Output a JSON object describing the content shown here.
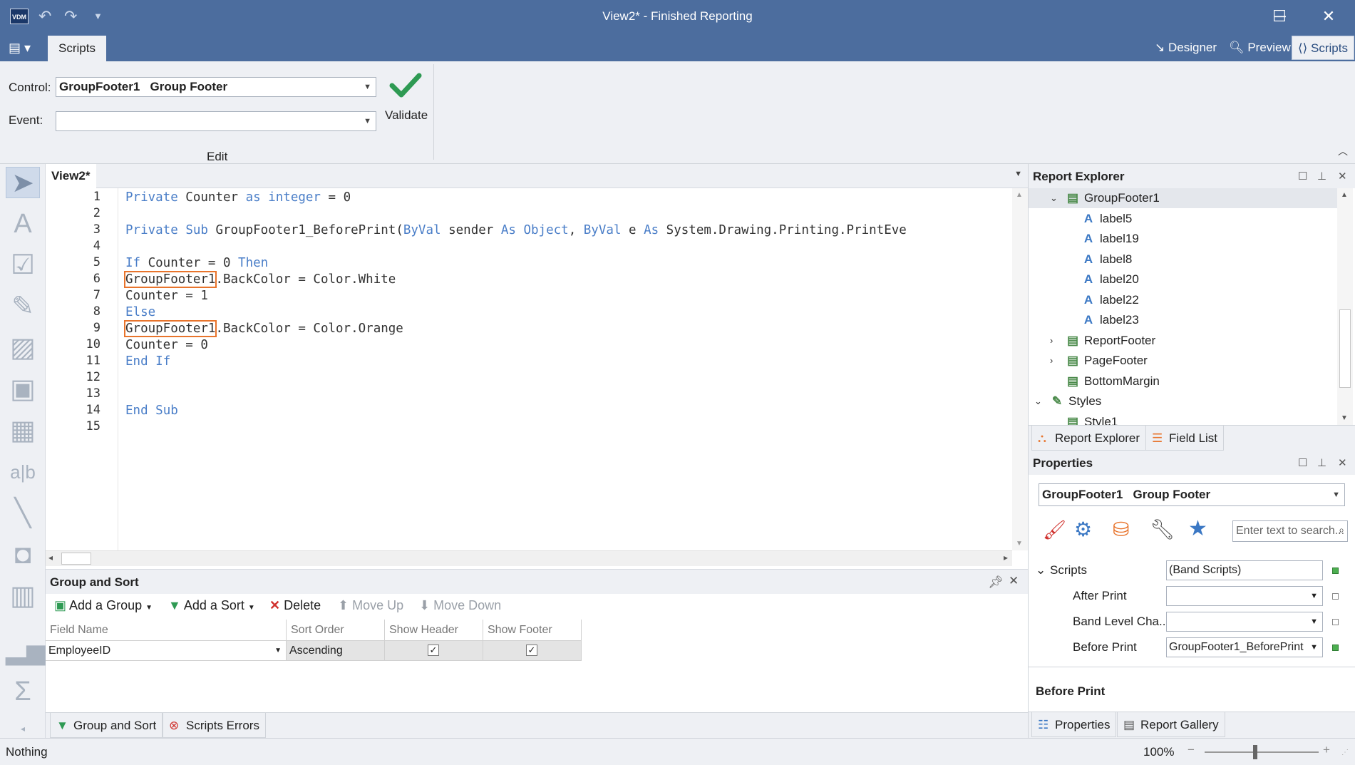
{
  "window": {
    "logo": "VDM",
    "title": "View2* - Finished Reporting",
    "minimize": "─",
    "maximize": "☐",
    "close": "✕"
  },
  "ribbon": {
    "tab_scripts": "Scripts",
    "views": {
      "designer": "Designer",
      "preview": "Preview",
      "scripts": "Scripts"
    },
    "control_label": "Control:",
    "control_value": "GroupFooter1   Group Footer",
    "event_label": "Event:",
    "event_value": "",
    "validate": "Validate",
    "group_label": "Edit"
  },
  "editor": {
    "tab": "View2*",
    "line_numbers": [
      "1",
      "2",
      "3",
      "4",
      "5",
      "6",
      "7",
      "8",
      "9",
      "10",
      "11",
      "12",
      "13",
      "14",
      "15"
    ],
    "lines": [
      {
        "parts": [
          {
            "t": "Private",
            "k": true
          },
          {
            "t": " Counter ",
            "k": false
          },
          {
            "t": "as",
            "k": true
          },
          {
            "t": " ",
            "k": false
          },
          {
            "t": "integer",
            "k": true
          },
          {
            "t": " = 0",
            "k": false
          }
        ]
      },
      {
        "parts": []
      },
      {
        "parts": [
          {
            "t": "Private",
            "k": true
          },
          {
            "t": " ",
            "k": false
          },
          {
            "t": "Sub",
            "k": true
          },
          {
            "t": " GroupFooter1_BeforePrint(",
            "k": false
          },
          {
            "t": "ByVal",
            "k": true
          },
          {
            "t": " sender ",
            "k": false
          },
          {
            "t": "As",
            "k": true
          },
          {
            "t": " ",
            "k": false
          },
          {
            "t": "Object",
            "k": true
          },
          {
            "t": ", ",
            "k": false
          },
          {
            "t": "ByVal",
            "k": true
          },
          {
            "t": " e ",
            "k": false
          },
          {
            "t": "As",
            "k": true
          },
          {
            "t": " System.Drawing.Printing.PrintEve",
            "k": false
          }
        ]
      },
      {
        "parts": []
      },
      {
        "parts": [
          {
            "t": "If",
            "k": true
          },
          {
            "t": " Counter = 0 ",
            "k": false
          },
          {
            "t": "Then",
            "k": true
          }
        ]
      },
      {
        "parts": [
          {
            "t": "GroupFooter1",
            "k": false,
            "h": true
          },
          {
            "t": ".BackColor = Color.White",
            "k": false
          }
        ]
      },
      {
        "parts": [
          {
            "t": "Counter = 1",
            "k": false
          }
        ]
      },
      {
        "parts": [
          {
            "t": "Else",
            "k": true
          }
        ]
      },
      {
        "parts": [
          {
            "t": "GroupFooter1",
            "k": false,
            "h": true
          },
          {
            "t": ".BackColor = Color.Orange",
            "k": false
          }
        ]
      },
      {
        "parts": [
          {
            "t": "Counter = 0",
            "k": false
          }
        ]
      },
      {
        "parts": [
          {
            "t": "End",
            "k": true
          },
          {
            "t": " ",
            "k": false
          },
          {
            "t": "If",
            "k": true
          }
        ]
      },
      {
        "parts": []
      },
      {
        "parts": []
      },
      {
        "parts": [
          {
            "t": "End",
            "k": true
          },
          {
            "t": " ",
            "k": false
          },
          {
            "t": "Sub",
            "k": true
          }
        ]
      },
      {
        "parts": []
      }
    ]
  },
  "group_sort": {
    "title": "Group and Sort",
    "add_group": "Add a Group",
    "add_sort": "Add a Sort",
    "delete": "Delete",
    "move_up": "Move Up",
    "move_down": "Move Down",
    "columns": [
      "Field Name",
      "Sort Order",
      "Show Header",
      "Show Footer"
    ],
    "row": {
      "field": "EmployeeID",
      "order": "Ascending",
      "show_header": true,
      "show_footer": true
    },
    "bottom_tabs": [
      "Group and Sort",
      "Scripts Errors"
    ]
  },
  "report_explorer": {
    "title": "Report Explorer",
    "items": [
      {
        "label": "GroupFooter1",
        "level": 1,
        "expander": "expanded",
        "selected": true
      },
      {
        "label": "label5",
        "level": 2
      },
      {
        "label": "label19",
        "level": 2
      },
      {
        "label": "label8",
        "level": 2
      },
      {
        "label": "label20",
        "level": 2
      },
      {
        "label": "label22",
        "level": 2
      },
      {
        "label": "label23",
        "level": 2
      },
      {
        "label": "ReportFooter",
        "level": 1,
        "expander": "collapsed"
      },
      {
        "label": "PageFooter",
        "level": 1,
        "expander": "collapsed"
      },
      {
        "label": "BottomMargin",
        "level": 1
      },
      {
        "label": "Styles",
        "level": 0,
        "expander": "expanded"
      },
      {
        "label": "Style1",
        "level": 1
      }
    ],
    "tabs": [
      "Report Explorer",
      "Field List"
    ]
  },
  "properties": {
    "title": "Properties",
    "selector": "GroupFooter1   Group Footer",
    "search_placeholder": "Enter text to search...",
    "category": "Scripts",
    "category_value": "(Band Scripts)",
    "rows": [
      {
        "name": "After Print",
        "value": ""
      },
      {
        "name": "Band Level Cha...",
        "value": ""
      },
      {
        "name": "Before Print",
        "value": "GroupFooter1_BeforePrint"
      }
    ],
    "description_title": "Before Print",
    "tabs": [
      "Properties",
      "Report Gallery"
    ]
  },
  "status": {
    "text": "Nothing",
    "zoom": "100%"
  },
  "colors": {
    "titlebar": "#4c6d9e",
    "keyword": "#4a7ec8",
    "highlight": "#e8742c"
  }
}
